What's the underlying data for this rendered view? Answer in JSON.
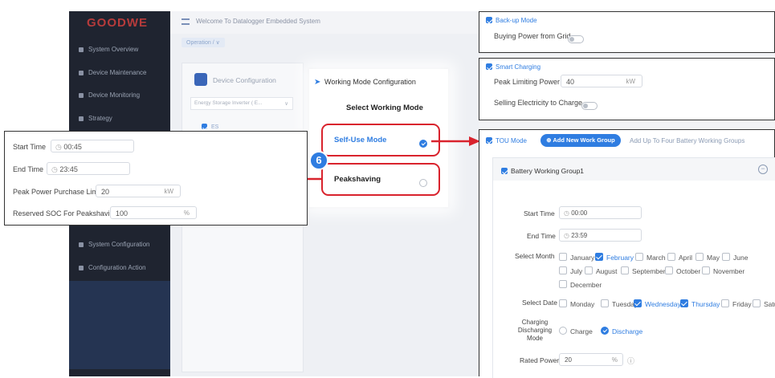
{
  "app": {
    "logo": "GOODWE",
    "welcome": "Welcome To Datalogger Embedded System",
    "breadcrumb": "Operation",
    "breadcrumb_sep": "/",
    "breadcrumb_dropdown": "∨"
  },
  "sidebar": {
    "items": [
      {
        "label": "System Overview",
        "icon": "overview-icon"
      },
      {
        "label": "Device Maintenance",
        "icon": "maintenance-icon"
      },
      {
        "label": "Device Monitoring",
        "icon": "monitoring-icon"
      },
      {
        "label": "Strategy",
        "icon": "strategy-icon"
      },
      {
        "label": "System Configuration",
        "icon": "config-icon"
      },
      {
        "label": "Configuration Action",
        "icon": "action-icon"
      }
    ]
  },
  "device_config": {
    "title": "Device Configuration",
    "select_value": "Energy Storage Inverter ( E...",
    "select_arrow": "∨",
    "list_item": "ES"
  },
  "working_mode": {
    "header": "Working Mode Configuration",
    "title": "Select Working Mode",
    "options": [
      {
        "label": "Self-Use Mode",
        "selected": true
      },
      {
        "label": "Peakshaving",
        "selected": false
      }
    ],
    "step_badge": "6"
  },
  "peak_popup": {
    "start_label": "Start Time",
    "start_value": "00:45",
    "end_label": "End Time",
    "end_value": "23:45",
    "limit_label": "Peak Power Purchase Limit",
    "limit_value": "20",
    "limit_unit": "kW",
    "soc_label": "Reserved SOC For Peakshaving",
    "soc_value": "100",
    "soc_unit": "%"
  },
  "backup": {
    "title": "Back-up Mode",
    "buying_label": "Buying Power from Grid"
  },
  "smart_charging": {
    "title": "Smart Charging",
    "peak_label": "Peak Limiting Power",
    "peak_value": "40",
    "peak_unit": "kW",
    "selling_label": "Selling Electricity to Charge"
  },
  "tou": {
    "title": "TOU Mode",
    "add_button": "Add New Work Group",
    "add_icon": "⊕",
    "hint": "Add Up To Four Battery Working Groups",
    "group_title": "Battery Working Group1",
    "start_label": "Start Time",
    "start_value": "00:00",
    "end_label": "End Time",
    "end_value": "23:59",
    "month_label": "Select Month",
    "months": [
      {
        "label": "January",
        "checked": false
      },
      {
        "label": "February",
        "checked": true
      },
      {
        "label": "March",
        "checked": false
      },
      {
        "label": "April",
        "checked": false
      },
      {
        "label": "May",
        "checked": false
      },
      {
        "label": "June",
        "checked": false
      },
      {
        "label": "July",
        "checked": false
      },
      {
        "label": "August",
        "checked": false
      },
      {
        "label": "September",
        "checked": false
      },
      {
        "label": "October",
        "checked": false
      },
      {
        "label": "November",
        "checked": false
      },
      {
        "label": "December",
        "checked": false
      }
    ],
    "date_label": "Select Date",
    "days": [
      {
        "label": "Monday",
        "checked": false
      },
      {
        "label": "Tuesday",
        "checked": false
      },
      {
        "label": "Wednesday",
        "checked": true
      },
      {
        "label": "Thursday",
        "checked": true
      },
      {
        "label": "Friday",
        "checked": false
      },
      {
        "label": "Satu",
        "checked": false
      }
    ],
    "mode_label_1": "Charging",
    "mode_label_2": "Discharging",
    "mode_label_3": "Mode",
    "charge_label": "Charge",
    "discharge_label": "Discharge",
    "rated_label": "Rated Power",
    "rated_value": "20",
    "rated_unit": "%",
    "help": "ⓘ"
  },
  "colors": {
    "accent": "#2f7de1",
    "arrow_red": "#d9232d",
    "sidebar": "#1f2430"
  }
}
